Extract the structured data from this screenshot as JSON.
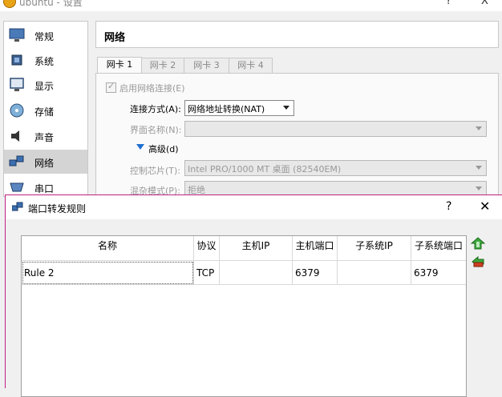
{
  "settings_window": {
    "title": "ubuntu - 设置",
    "help_glyph": "?",
    "close_glyph": "X",
    "sidebar": [
      {
        "label": "常规",
        "icon": "monitor-icon"
      },
      {
        "label": "系统",
        "icon": "chip-icon"
      },
      {
        "label": "显示",
        "icon": "display-icon"
      },
      {
        "label": "存储",
        "icon": "disk-icon"
      },
      {
        "label": "声音",
        "icon": "speaker-icon"
      },
      {
        "label": "网络",
        "icon": "network-icon",
        "active": true
      },
      {
        "label": "串口",
        "icon": "serial-port-icon"
      }
    ],
    "section_title": "网络",
    "tabs": [
      "网卡 1",
      "网卡 2",
      "网卡 3",
      "网卡 4"
    ],
    "enable_label": "启用网络连接(E)",
    "attach_label": "连接方式(A):",
    "attach_value": "网络地址转换(NAT)",
    "name_label": "界面名称(N):",
    "advanced_label": "高级(d)",
    "adapter_label": "控制芯片(T):",
    "adapter_value": "Intel PRO/1000 MT 桌面 (82540EM)",
    "promisc_label": "混杂模式(P):",
    "promisc_value": "拒绝"
  },
  "port_forwarding_dialog": {
    "title": "端口转发规则",
    "help_glyph": "?",
    "close_glyph": "✕",
    "columns": [
      "名称",
      "协议",
      "主机IP",
      "主机端口",
      "子系统IP",
      "子系统端口"
    ],
    "rows": [
      {
        "name": "Rule 2",
        "protocol": "TCP",
        "host_ip": "",
        "host_port": "6379",
        "guest_ip": "",
        "guest_port": "6379"
      }
    ]
  },
  "colors": {
    "accent": "#1f6fd0",
    "dialog_border": "#c02080",
    "add_green": "#3aa83a",
    "remove_red": "#d04020"
  }
}
